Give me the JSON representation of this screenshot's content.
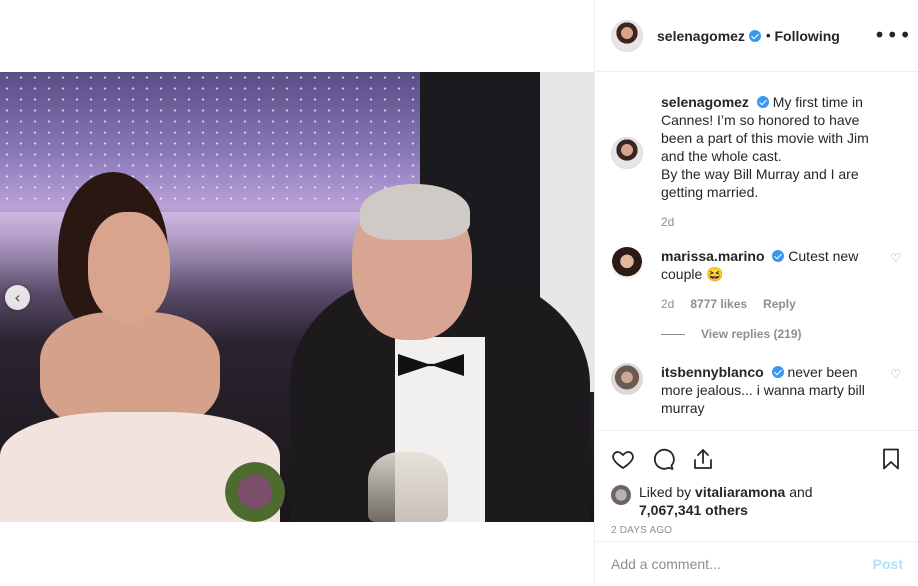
{
  "header": {
    "username": "selenagomez",
    "separator": "•",
    "follow_status": "Following",
    "more_icon": "more-horizontal-icon"
  },
  "caption": {
    "username": "selenagomez",
    "text_line1": "My first time in Cannes! I’m so honored to have been a part of this movie with Jim and the whole cast.",
    "text_line2": "By the way Bill Murray and I are getting married.",
    "age": "2d"
  },
  "comments": [
    {
      "username": "marissa.marino",
      "text": "Cutest new couple 😆",
      "age": "2d",
      "likes": "8777 likes",
      "reply_label": "Reply",
      "view_replies": "View replies (219)"
    },
    {
      "username": "itsbennyblanco",
      "text": "never been more jealous... i wanna marty bill murray"
    }
  ],
  "actions": {
    "like_icon": "heart-icon",
    "comment_icon": "comment-icon",
    "share_icon": "share-icon",
    "save_icon": "bookmark-icon"
  },
  "likes": {
    "liked_by_prefix": "Liked by",
    "liked_by_user": "vitaliaramona",
    "and": "and",
    "others": "7,067,341 others"
  },
  "timestamp": "2 days ago",
  "add_comment": {
    "placeholder": "Add a comment...",
    "post_label": "Post"
  },
  "colors": {
    "verified": "#3897f0",
    "secondary_text": "#8e8e8e",
    "primary_text": "#262626",
    "post_disabled": "#b2dffc",
    "border": "#efefef"
  }
}
